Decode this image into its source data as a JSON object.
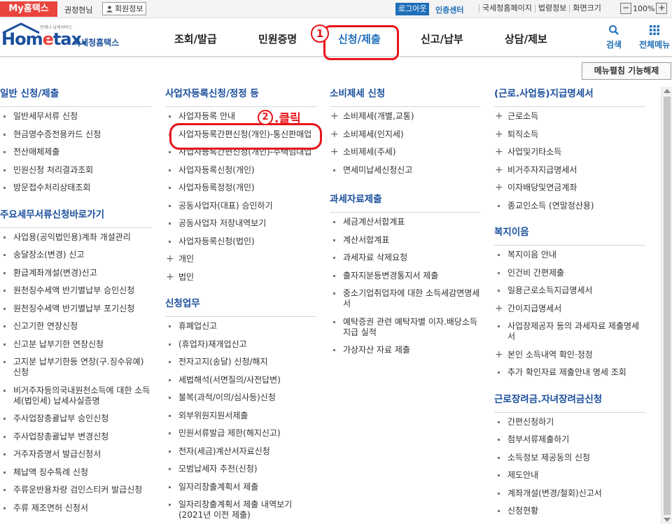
{
  "topbar": {
    "my_hometax": "My홈택스",
    "username": "권정현님",
    "member_info": "회원정보",
    "logout": "로그아웃",
    "cert_center": "인증센터",
    "links": [
      "국세청홈페이지",
      "법령정보",
      "화면크기"
    ],
    "zoom_minus": "−",
    "zoom_level": "100%",
    "zoom_plus": "+"
  },
  "header": {
    "logo_ho": "Hom",
    "logo_e": "e",
    "logo_tax": "tax.",
    "logo_sub": "국세청홈택스",
    "logo_tiny": "언제나 납세서비스",
    "nav": [
      "조회/발급",
      "민원증명",
      "신청/제출",
      "신고/납부",
      "상담/제보"
    ],
    "search_label": "검색",
    "allmenu_label": "전체메뉴",
    "annot_1": "1"
  },
  "collapse_button": "메뉴펼침 기능해제",
  "annot_2": {
    "num": "2",
    "text": ".클릭"
  },
  "col1": {
    "s1_title": "일반 신청/제출",
    "s1_items": [
      "일반세무서류 신청",
      "현금영수증전용카드 신청",
      "전산매체제출",
      "민원신청 처리결과조회",
      "방문접수처리상태조회"
    ],
    "s2_title": "주요세무서류신청바로가기",
    "s2_items": [
      "사업용(공익법인용)계좌 개설관리",
      "송달장소(변경) 신고",
      "환급계좌개설(변경)신고",
      "원천징수세액 반기별납부 승인신청",
      "원천징수세액 반기별납부 포기신청",
      "신고기한 연장신청",
      "신고분 납부기한 연장신청",
      "고지분 납부기한등 연장(구.징수유예) 신청",
      "비거주자등의국내원천소득에 대한 소득세(법인세) 납세사실증명",
      "주사업장총괄납부 승인신청",
      "주사업장총괄납부 변경신청",
      "거주자증명서 발급신청서",
      "체납액 징수특례 신청",
      "주류운반용차량 검인스티커 발급신청",
      "주류 제조면허 신청서"
    ]
  },
  "col2": {
    "s1_title": "사업자등록신청/정정 등",
    "s1_items": [
      "사업자등록 안내",
      "사업자등록간편신청(개인)-통신판매업",
      "사업자등록간편신청(개인)-주택임대업",
      "사업자등록신청(개인)",
      "사업자등록정정(개인)",
      "공동사업자(대표) 승인하기",
      "공동사업자 저장내역보기",
      "사업자등록신청(법인)"
    ],
    "s1_plus": [
      "개인",
      "법인"
    ],
    "s2_title": "신청업무",
    "s2_items": [
      "휴폐업신고",
      "(휴업자)재개업신고",
      "전자고지(송달) 신청/해지",
      "세법해석(서면질의/사전답변)",
      "불복(과적/이의/심사등)신청",
      "외부위원지원서제출",
      "민원서류발급 제한(해지신고)",
      "전자(세금)계산서자료신청",
      "모범납세자 추천(신청)",
      "일자리창출계획서 제출",
      "일자리창출계획서 제출 내역보기(2021년 이전 제출)"
    ]
  },
  "col3": {
    "s1_title": "소비제세 신청",
    "s1_plus": [
      "소비제세(개별,교통)",
      "소비제세(인지세)",
      "소비제세(주세)"
    ],
    "s1_items": [
      "면세미납세신청신고"
    ],
    "s2_title": "과세자료제출",
    "s2_items": [
      "세금계산서합계표",
      "계산서합계표",
      "과세자료 삭제요청",
      "출자지분등변경통지서 제출",
      "중소기업취업자에 대한 소득세감면명세서",
      "예탁증권 관련 예탁자별 이자.배당소득 지급 실적",
      "가상자산 자료 제출"
    ]
  },
  "col4": {
    "s1_title": "(근로.사업등)지급명세서",
    "s1_plus": [
      "근로소득",
      "퇴직소득",
      "사업및기타소득",
      "비거주자지급명세서",
      "이자배당및연금계좌"
    ],
    "s1_items": [
      "종교인소득 (연말정산용)"
    ],
    "s2_title": "복지이음",
    "s2_items": [
      "복지이음 안내",
      "인건비 간편제출",
      "일용근로소득지급명세서"
    ],
    "s2_plus": [
      "간이지급명세서"
    ],
    "s2_items_b": [
      "사업장제공자 등의 과세자료 제출명세서"
    ],
    "s2_plus_b": [
      "본인 소득내역 확인·정정"
    ],
    "s2_items_c": [
      "추가 확인자료 제출안내 명세 조회"
    ],
    "s3_title": "근로장려금.자녀장려금신청",
    "s3_items": [
      "간편신청하기",
      "첨부서류제출하기",
      "소득정보 제공동의 신청",
      "제도안내",
      "계좌개설(변경/철회)신고서",
      "신청현황"
    ]
  }
}
